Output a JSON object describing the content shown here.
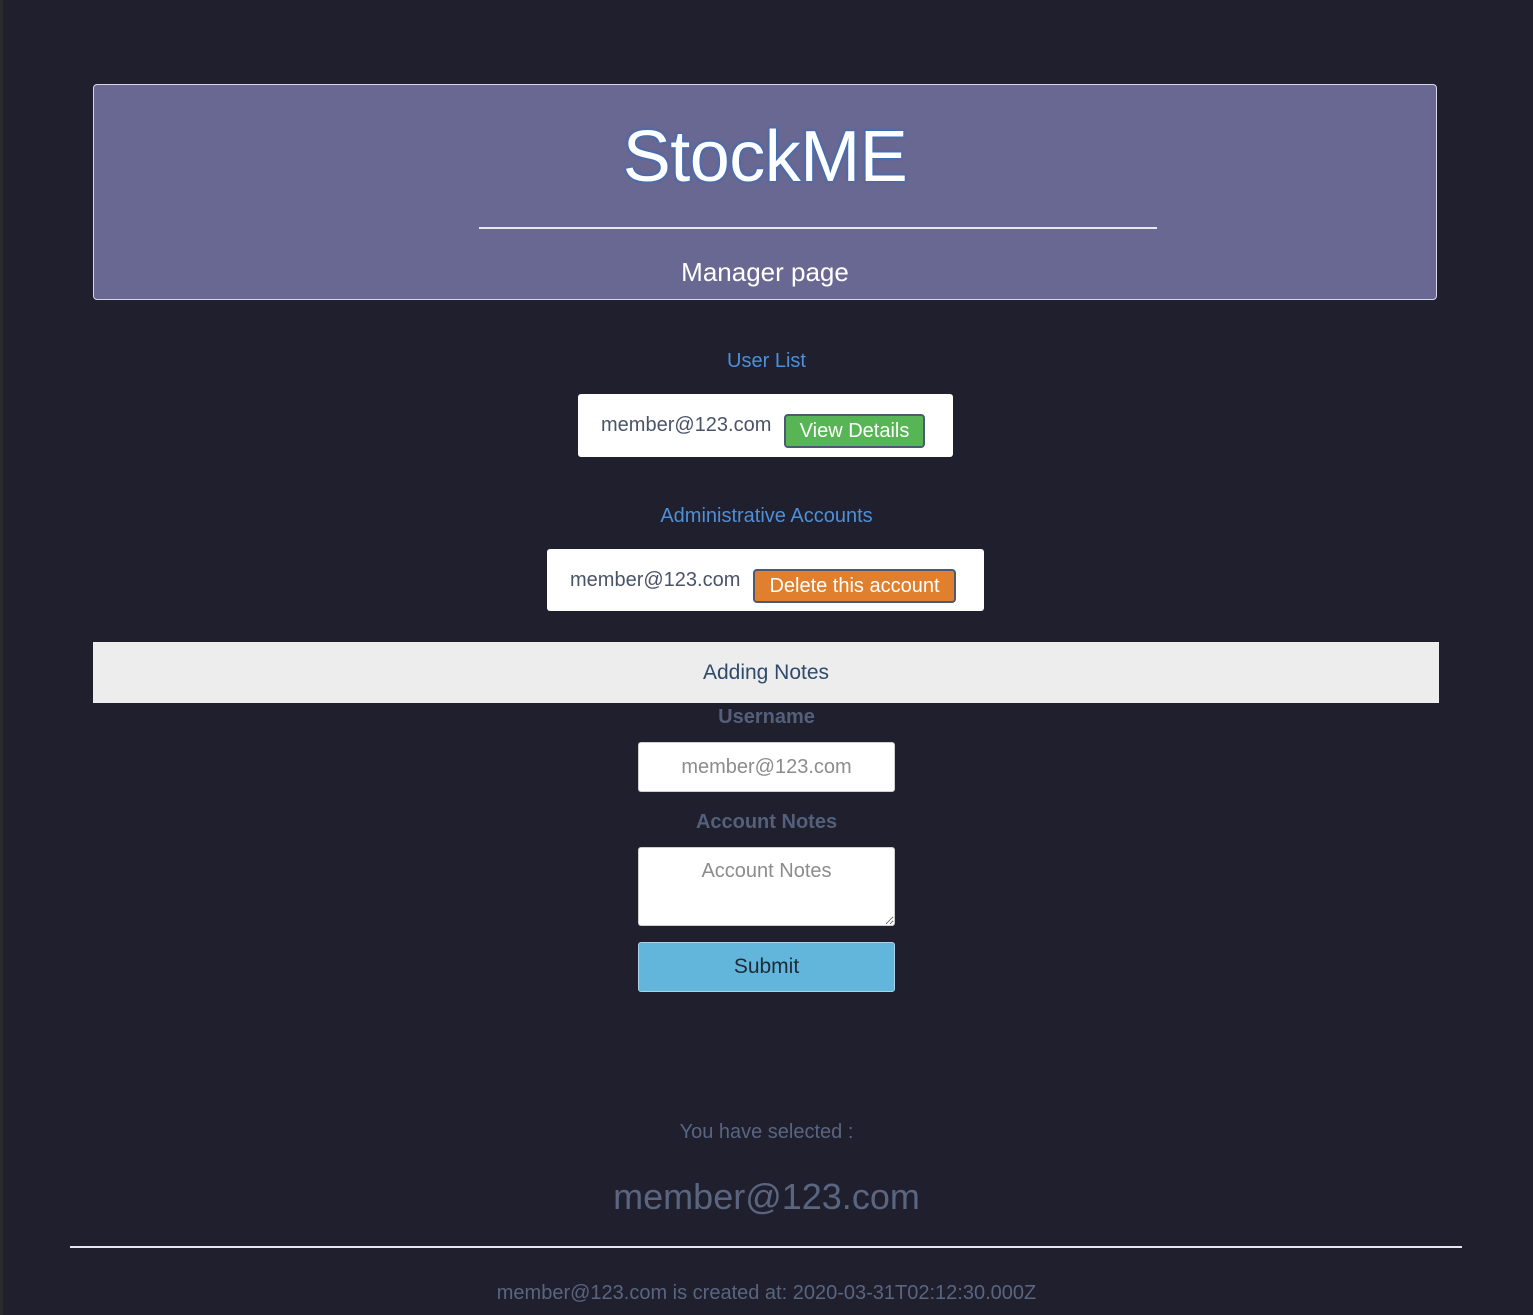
{
  "header": {
    "app_title": "StockME",
    "page_subtitle": "Manager page"
  },
  "user_list": {
    "label": "User List",
    "items": [
      {
        "email": "member@123.com",
        "action_label": "View Details"
      }
    ]
  },
  "admin_accounts": {
    "label": "Administrative Accounts",
    "items": [
      {
        "email": "member@123.com",
        "action_label": "Delete this account"
      }
    ]
  },
  "notes_form": {
    "title": "Adding Notes",
    "username_label": "Username",
    "username_placeholder": "member@123.com",
    "notes_label": "Account Notes",
    "notes_placeholder": "Account Notes",
    "submit_label": "Submit"
  },
  "selection": {
    "label": "You have selected :",
    "value": "member@123.com",
    "created_text": "member@123.com is created at: 2020-03-31T02:12:30.000Z"
  },
  "colors": {
    "background": "#1f1f2d",
    "header_bg": "#686893",
    "section_label": "#4f8fd6",
    "view_button": "#58b555",
    "delete_button": "#e0802e",
    "submit_button": "#62b5db"
  }
}
